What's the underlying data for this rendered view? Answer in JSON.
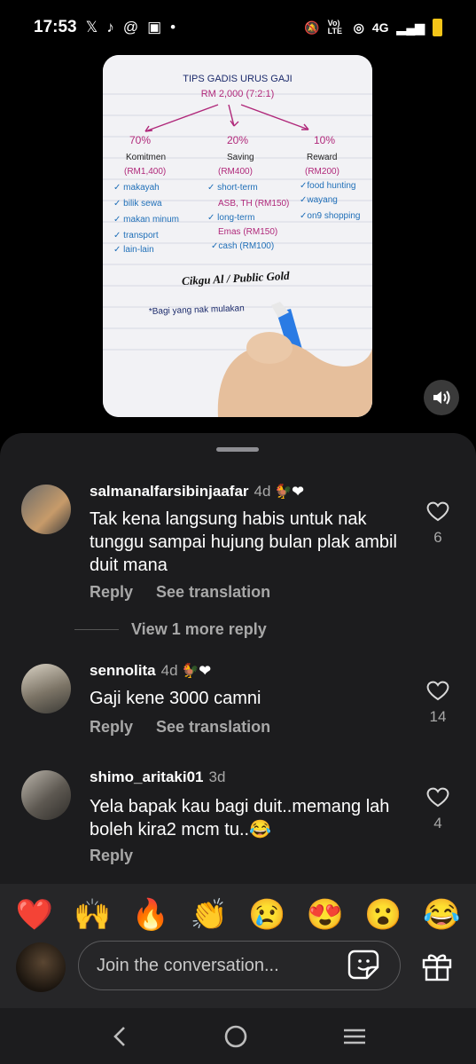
{
  "status": {
    "time": "17:53",
    "network": "4G",
    "volte": "Vo) LTE"
  },
  "video": {
    "note_title": "TIPS  GADIS  URUS  GAJI",
    "note_amount": "RM 2,000 (7:2:1)",
    "columns": [
      {
        "pct": "70%",
        "name": "Komitmen",
        "amount": "(RM1,400)",
        "items": [
          "makayah",
          "bilik sewa",
          "makan minum",
          "transport",
          "lain-lain"
        ]
      },
      {
        "pct": "20%",
        "name": "Saving",
        "amount": "(RM400)",
        "items": [
          "short-term",
          "ASB, TH (RM150)",
          "long-term",
          "Emas (RM150)",
          "cash (RM100)"
        ]
      },
      {
        "pct": "10%",
        "name": "Reward",
        "amount": "(RM200)",
        "items": [
          "food hunting",
          "wayang",
          "on9 shopping"
        ]
      }
    ],
    "signature": "Cikgu Al / Public Gold",
    "footnote": "*Bagi yang nak mulakan"
  },
  "comments": [
    {
      "username": "salmanalfarsibinjaafar",
      "ago": "4d",
      "badge": "🐓❤",
      "text": "Tak kena langsung habis untuk nak tunggu sampai hujung bulan plak ambil duit mana",
      "reply": "Reply",
      "translate": "See translation",
      "likes": "6"
    },
    {
      "username": "sennolita",
      "ago": "4d",
      "badge": "🐓❤",
      "text": "Gaji kene 3000 camni",
      "reply": "Reply",
      "translate": "See translation",
      "likes": "14"
    },
    {
      "username": "shimo_aritaki01",
      "ago": "3d",
      "badge": "",
      "text": "Yela bapak kau bagi duit..memang lah boleh kira2 mcm tu..😂",
      "reply": "Reply",
      "translate": "",
      "likes": "4"
    }
  ],
  "view_more_replies": "View 1 more reply",
  "emoji_bar": [
    "❤️",
    "🙌",
    "🔥",
    "👏",
    "😢",
    "😍",
    "😮",
    "😂"
  ],
  "composer": {
    "placeholder": "Join the conversation..."
  },
  "colors": {
    "sheet": "#1c1c1e",
    "muted": "#a8a8a8",
    "pen_magenta": "#b0287a",
    "pen_blue": "#1f6fb8"
  }
}
